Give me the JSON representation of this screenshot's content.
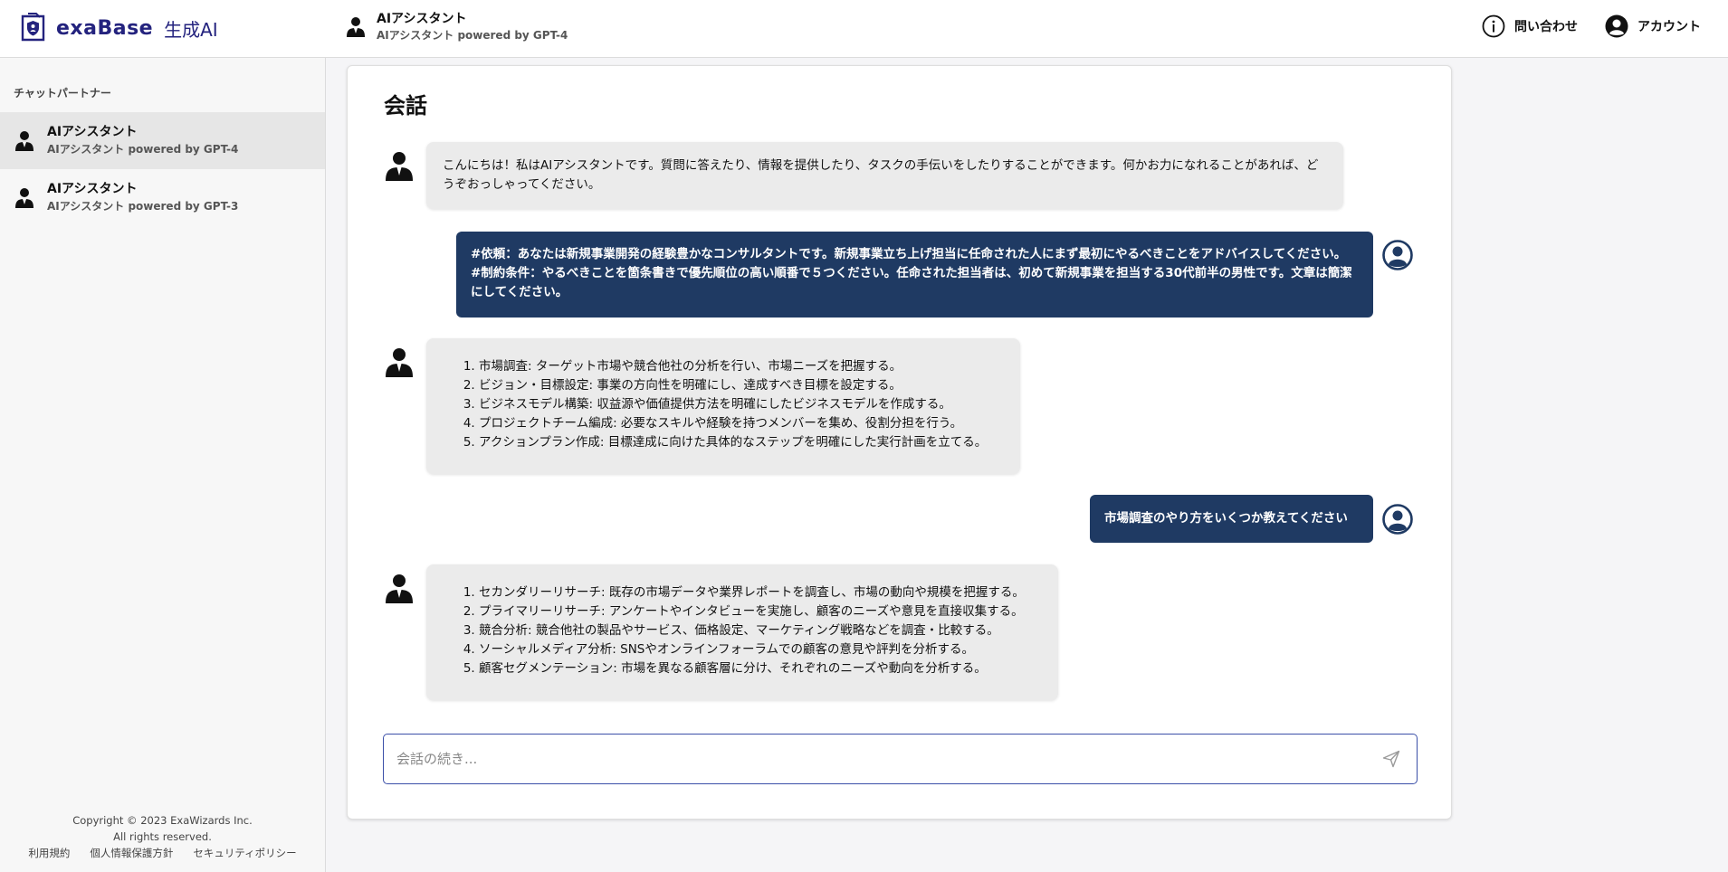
{
  "header": {
    "logo_text": "exaBase",
    "logo_sub": "生成AI",
    "assistant_name": "AIアシスタント",
    "assistant_sub": "AIアシスタント powered by GPT-4",
    "contact_label": "問い合わせ",
    "account_label": "アカウント"
  },
  "sidebar": {
    "title": "チャットパートナー",
    "items": [
      {
        "name": "AIアシスタント",
        "sub": "AIアシスタント powered by GPT-4",
        "active": true
      },
      {
        "name": "AIアシスタント",
        "sub": "AIアシスタント powered by GPT-3",
        "active": false
      }
    ],
    "copyright": "Copyright © 2023 ExaWizards Inc.",
    "rights": "All rights reserved.",
    "links": [
      "利用規約",
      "個人情報保護方針",
      "セキュリティポリシー"
    ]
  },
  "conversation": {
    "title": "会話",
    "messages": [
      {
        "role": "ai",
        "text": "こんにちは！私はAIアシスタントです。質問に答えたり、情報を提供したり、タスクの手伝いをしたりすることができます。何かお力になれることがあれば、どうぞおっしゃってください。"
      },
      {
        "role": "user",
        "text": "#依頼：あなたは新規事業開発の経験豊かなコンサルタントです。新規事業立ち上げ担当に任命された人にまず最初にやるべきことをアドバイスしてください。　#制約条件：やるべきことを箇条書きで優先順位の高い順番で５つください。任命された担当者は、初めて新規事業を担当する30代前半の男性です。文章は簡潔にしてください。"
      },
      {
        "role": "ai",
        "items": [
          "市場調査: ターゲット市場や競合他社の分析を行い、市場ニーズを把握する。",
          "ビジョン・目標設定: 事業の方向性を明確にし、達成すべき目標を設定する。",
          "ビジネスモデル構築: 収益源や価値提供方法を明確にしたビジネスモデルを作成する。",
          "プロジェクトチーム編成: 必要なスキルや経験を持つメンバーを集め、役割分担を行う。",
          "アクションプラン作成: 目標達成に向けた具体的なステップを明確にした実行計画を立てる。"
        ]
      },
      {
        "role": "user",
        "text": "市場調査のやり方をいくつか教えてください"
      },
      {
        "role": "ai",
        "items": [
          "セカンダリーリサーチ: 既存の市場データや業界レポートを調査し、市場の動向や規模を把握する。",
          "プライマリーリサーチ: アンケートやインタビューを実施し、顧客のニーズや意見を直接収集する。",
          "競合分析: 競合他社の製品やサービス、価格設定、マーケティング戦略などを調査・比較する。",
          "ソーシャルメディア分析: SNSやオンラインフォーラムでの顧客の意見や評判を分析する。",
          "顧客セグメンテーション: 市場を異なる顧客層に分け、それぞれのニーズや動向を分析する。"
        ]
      }
    ]
  },
  "input": {
    "placeholder": "会話の続き..."
  },
  "colors": {
    "brand": "#24237e",
    "user_bubble": "#1f3a63",
    "ai_bubble": "#ebebeb",
    "input_border": "#3b4fa8"
  },
  "icons": {
    "assistant": "person-icon",
    "user": "user-avatar-icon",
    "contact": "info-icon",
    "account": "account-icon",
    "send": "send-icon"
  }
}
